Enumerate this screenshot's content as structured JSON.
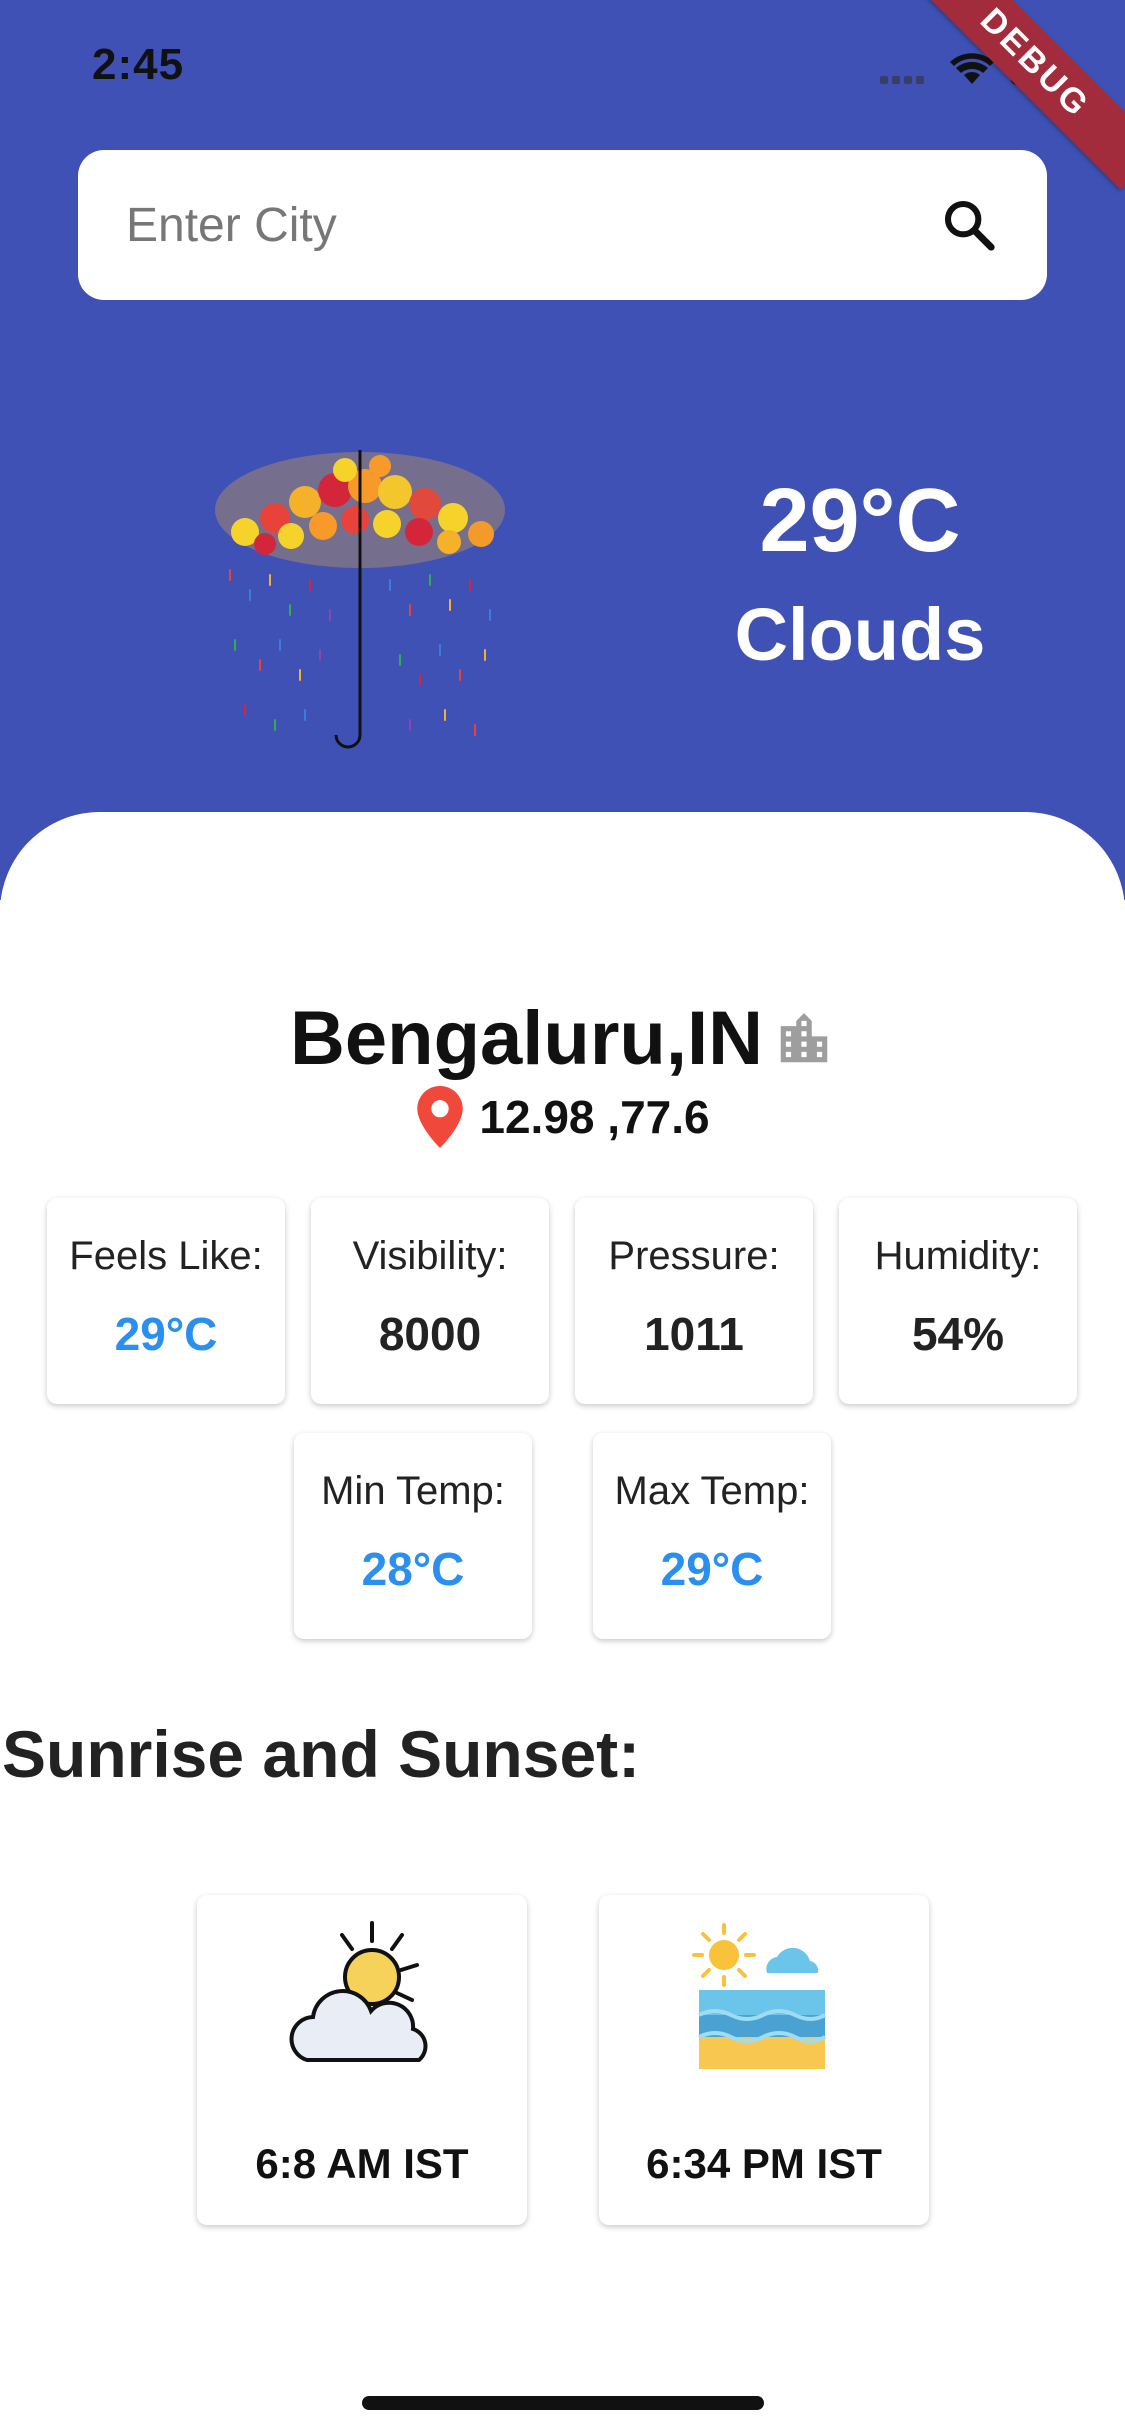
{
  "status_bar": {
    "time": "2:45",
    "debug_label": "DEBUG"
  },
  "search": {
    "placeholder": "Enter City",
    "value": ""
  },
  "current": {
    "temperature": "29°C",
    "condition": "Clouds"
  },
  "location": {
    "city": "Bengaluru,IN",
    "coords": "12.98 ,77.6"
  },
  "stats": [
    {
      "label": "Feels Like:",
      "value": "29°C"
    },
    {
      "label": "Visibility:",
      "value": "8000"
    },
    {
      "label": "Pressure:",
      "value": "1011"
    },
    {
      "label": "Humidity:",
      "value": "54%"
    },
    {
      "label": "Min Temp:",
      "value": "28°C"
    },
    {
      "label": "Max Temp:",
      "value": "29°C"
    }
  ],
  "sun": {
    "title": "Sunrise and Sunset:",
    "sunrise": "6:8 AM IST",
    "sunset": "6:34 PM IST"
  },
  "colors": {
    "hero_bg": "#4051b5",
    "accent_blue": "#2b8ff0",
    "debug_banner": "#a32c3c"
  }
}
